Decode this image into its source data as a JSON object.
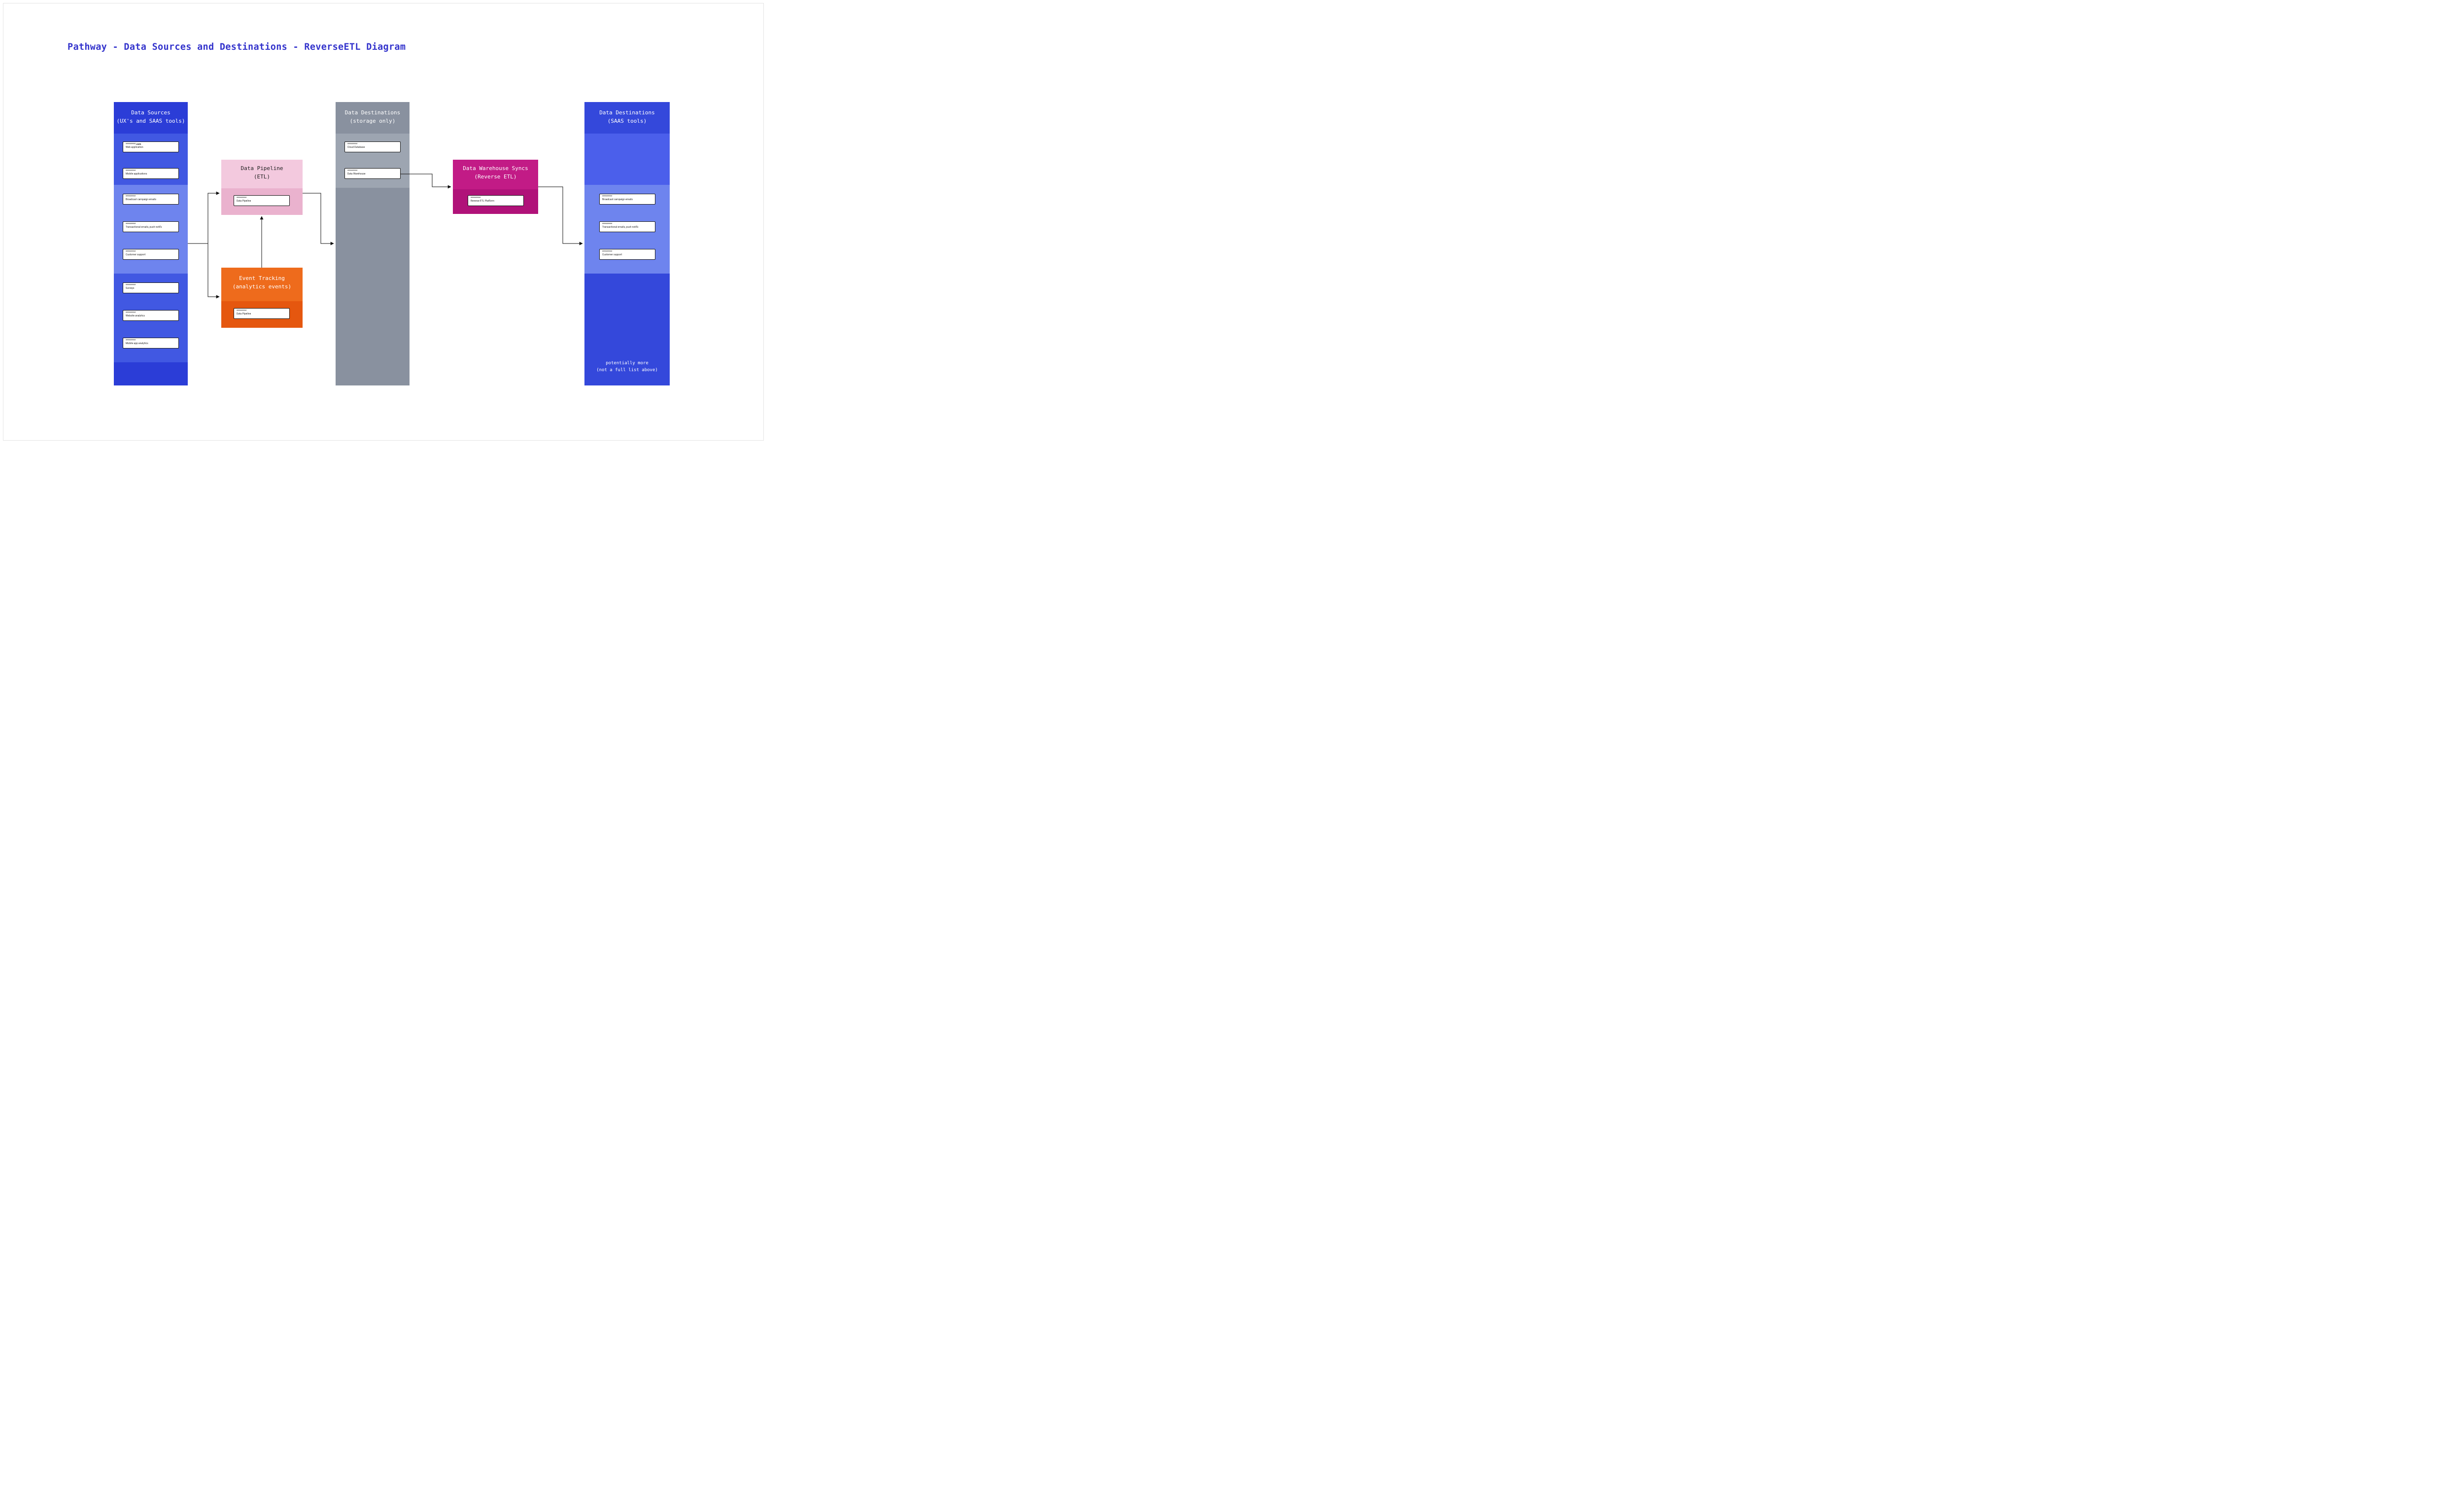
{
  "title": "Pathway - Data Sources and Destinations - ReverseETL Diagram",
  "columns": {
    "sources": {
      "title_line1": "Data Sources",
      "title_line2": "(UX's and SAAS tools)",
      "groups": {
        "group1": {
          "items": [
            {
              "name": "*********.com",
              "desc": "Web application"
            },
            {
              "name": "*********",
              "desc": "Mobile applications"
            }
          ]
        },
        "group2": {
          "items": [
            {
              "name": "*********",
              "desc": "Broadcast campaign emails"
            },
            {
              "name": "*********",
              "desc": "Transactional emails, push notifs"
            },
            {
              "name": "*********",
              "desc": "Customer support"
            }
          ]
        },
        "group3": {
          "items": [
            {
              "name": "*********",
              "desc": "Surveys"
            },
            {
              "name": "*********",
              "desc": "Website analytics"
            },
            {
              "name": "*********",
              "desc": "Mobile app analytics"
            }
          ]
        }
      }
    },
    "pipeline_etl": {
      "title_line1": "Data Pipeline",
      "title_line2": "(ETL)",
      "items": [
        {
          "name": "*********",
          "desc": "Data Pipeline"
        }
      ]
    },
    "event_tracking": {
      "title_line1": "Event Tracking",
      "title_line2": "(analytics events)",
      "items": [
        {
          "name": "*********",
          "desc": "Data Pipeline"
        }
      ]
    },
    "storage": {
      "title_line1": "Data Destinations",
      "title_line2": "(storage only)",
      "items": [
        {
          "name": "*********",
          "desc": "Cloud Database"
        },
        {
          "name": "*********",
          "desc": "Data Warehouse"
        }
      ]
    },
    "reverse_etl": {
      "title_line1": "Data Warehouse Syncs",
      "title_line2": "(Reverse ETL)",
      "items": [
        {
          "name": "*********",
          "desc": "Reverse ETL Platform"
        }
      ]
    },
    "saas_dest": {
      "title_line1": "Data Destinations",
      "title_line2": "(SAAS tools)",
      "items": [
        {
          "name": "*********",
          "desc": "Broadcast campaign emails"
        },
        {
          "name": "*********",
          "desc": "Transactional emails, push notifs"
        },
        {
          "name": "*********",
          "desc": "Customer support"
        }
      ],
      "note_line1": "potentially more",
      "note_line2": "(not a full list above)"
    }
  }
}
